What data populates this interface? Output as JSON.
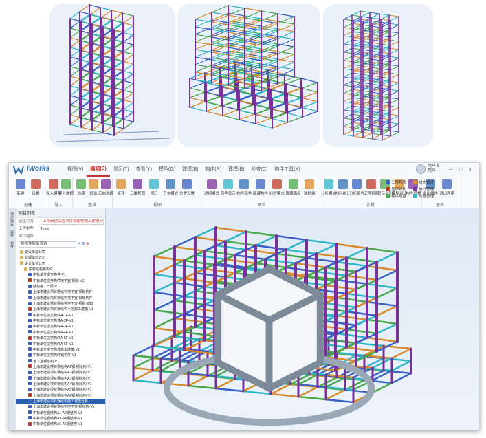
{
  "app": {
    "name": "iWorks",
    "menu": [
      "视图(V)",
      "编辑(E)",
      "显示(T)",
      "查看(Y)",
      "模型(G)",
      "建模(B)",
      "构件(R)",
      "建模(B)",
      "检查(C)",
      "构件工具(X)"
    ],
    "active_menu_index": 1,
    "user": {
      "name": "用户名 用户"
    },
    "window_controls": "－ □ ×"
  },
  "ribbon": {
    "groups": [
      {
        "label": "创建",
        "buttons": [
          "新建",
          "设置"
        ]
      },
      {
        "label": "导入",
        "buttons": [
          "导入模型",
          "导入数据"
        ]
      },
      {
        "label": "选择",
        "buttons": [
          "选择",
          "框选",
          "反向选择"
        ]
      },
      {
        "label": "视图",
        "buttons": [
          "旋转",
          "三维视图",
          "视口",
          "正交模式",
          "位置设置"
        ]
      },
      {
        "label": "显示",
        "buttons": [
          "透视模式",
          "颜色显示",
          "构件颜色",
          "隐藏构件",
          "线框模式",
          "隐藏面板",
          "辅助线"
        ]
      },
      {
        "label": "计算",
        "buttons": [
          "分析模式",
          "材料统计",
          "分析报告",
          "工程列表",
          "显示对比",
          "模型对比",
          "构件设置"
        ]
      },
      {
        "label": "退出",
        "buttons": [
          "退出插件",
          "退出程序"
        ]
      }
    ],
    "small_buttons": [
      "工程列表",
      "显示对比",
      "构件设置",
      "状态管理",
      "统计管理",
      "数据管理"
    ]
  },
  "side_tabs": [
    "项目列表",
    "属性",
    "构件"
  ],
  "panel": {
    "title": "项目列表",
    "project_label": "选择打开:",
    "project_value": "上海新建高层项目钢结构施工建模分析",
    "type_label": "工程类型:",
    "type_value": "Tekla",
    "group_label": "项目组件:",
    "filter_value": "按组件层级查看",
    "tree": [
      "建设单位公司",
      "监理单位公司",
      "设计单位公司",
      "中标结构钢构件",
      "中标单位提交构件-V1",
      "中标单位提交构件地下室-钢板-V1",
      "结构施工一层-V1",
      "上海市建设项目钢结构地下室-钢板构件",
      "上海市建设项目钢结构地下室-钢板构件",
      "上海市建设项目钢结构地下室-钢板-B03",
      "上海市建设项目钢结构一层施工建模-V1",
      "中标单位提交构件A-1F-V1",
      "中标单位提交构件A-2F-V1",
      "中标单位提交构件A-3F-V1",
      "中标单位提交构件A-4F-V1",
      "中标单位提交构件A-5F-V1",
      "中标单位提交构件A-6F-V1",
      "中标单位提交构件施工建模-V1",
      "中标单位提交构件钢构件-V1",
      "地下室钢结构-V1",
      "上海市建设项目钢结构A1钢-钢结构-V1",
      "上海市建设项目钢结构A2钢-钢结构-V1",
      "上海市建设项目钢结构A3钢-钢结构-V1",
      "上海市建设项目钢结构A4钢-钢结构-V1",
      "上海市建设项目钢结构A5钢-钢结构-V1",
      "上海市建设项目钢结构A6钢-钢结构-V1",
      "上海市建设项目钢结构施工建模分析",
      "上海市建设项目钢结构地下室-钢结构-V1",
      "中标单位钢结构A1-A2钢结构-V1",
      "中标单位钢结构A3-A4钢结构-V1",
      "中标单位钢结构A5-A6钢结构-V1"
    ],
    "highlighted_index": 26
  },
  "colors": {
    "accent": "#c0392b",
    "highlight": "#2f5fb3",
    "column": "#7a2f9b",
    "beam_cyan": "#2fb6c8",
    "beam_orange": "#d98a2b",
    "beam_green": "#4aa84a",
    "beam_blue": "#3a62c4"
  }
}
